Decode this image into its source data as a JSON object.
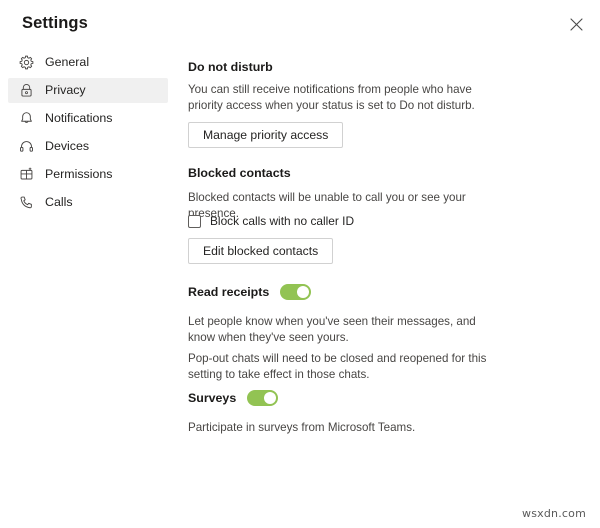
{
  "window": {
    "title": "Settings",
    "close_icon": "close-icon"
  },
  "sidebar": {
    "items": [
      {
        "label": "General",
        "icon": "gear-icon",
        "selected": false
      },
      {
        "label": "Privacy",
        "icon": "lock-icon",
        "selected": true
      },
      {
        "label": "Notifications",
        "icon": "bell-icon",
        "selected": false
      },
      {
        "label": "Devices",
        "icon": "headset-icon",
        "selected": false
      },
      {
        "label": "Permissions",
        "icon": "permissions-grid-icon",
        "selected": false
      },
      {
        "label": "Calls",
        "icon": "phone-icon",
        "selected": false
      }
    ]
  },
  "main": {
    "do_not_disturb": {
      "heading": "Do not disturb",
      "description": "You can still receive notifications from people who have priority access when your status is set to Do not disturb.",
      "button_label": "Manage priority access"
    },
    "blocked_contacts": {
      "heading": "Blocked contacts",
      "description": "Blocked contacts will be unable to call you or see your presence.",
      "checkbox_label": "Block calls with no caller ID",
      "checkbox_checked": "false",
      "button_label": "Edit blocked contacts"
    },
    "read_receipts": {
      "label": "Read receipts",
      "toggle_state": "on",
      "description_1": "Let people know when you've seen their messages, and know when they've seen yours.",
      "description_2": "Pop-out chats will need to be closed and reopened for this setting to take effect in those chats."
    },
    "surveys": {
      "label": "Surveys",
      "toggle_state": "on",
      "description": "Participate in surveys from Microsoft Teams."
    }
  },
  "watermark": "wsxdn.com",
  "colors": {
    "toggle_on": "#92c353",
    "selected_row": "#f0f0f0",
    "text_primary": "#252423",
    "text_secondary": "#484644"
  }
}
